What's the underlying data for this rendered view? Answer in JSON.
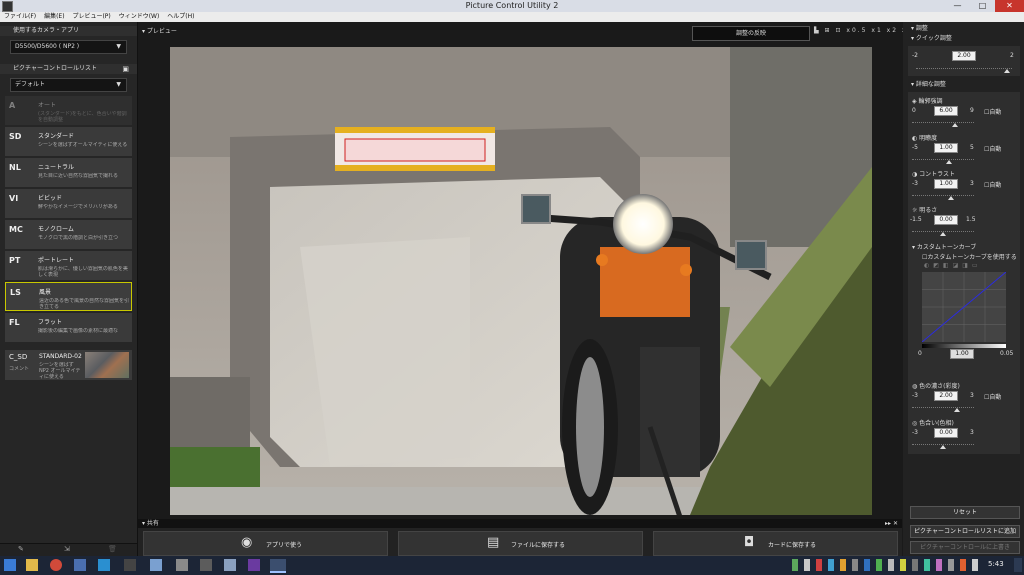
{
  "window": {
    "title": "Picture Control Utility 2",
    "minimize": "—",
    "maximize": "□",
    "close": "✕"
  },
  "menu": [
    "ファイル(F)",
    "編集(E)",
    "プレビュー(P)",
    "ウィンドウ(W)",
    "ヘルプ(H)"
  ],
  "left": {
    "camera_header": "使用するカメラ・アプリ",
    "camera_value": "D5500/D5600 ( NP2 )",
    "list_header": "ピクチャーコントロールリスト",
    "list_dropdown": "デフォルト",
    "items": [
      {
        "code": "A",
        "name": "オート",
        "desc": "(スタンダード)をもとに、色合いや階調を自動調整",
        "disabled": true
      },
      {
        "code": "SD",
        "name": "スタンダード",
        "desc": "シーンを選ばずオールマイティに使える"
      },
      {
        "code": "NL",
        "name": "ニュートラル",
        "desc": "見た目に近い自然な雰囲気で撮れる"
      },
      {
        "code": "VI",
        "name": "ビビッド",
        "desc": "鮮やかなイメージでメリハリがある"
      },
      {
        "code": "MC",
        "name": "モノクローム",
        "desc": "モノクロで黒の階調と白が引き立つ"
      },
      {
        "code": "PT",
        "name": "ポートレート",
        "desc": "肌は滑らかに、優しい雰囲気の肌色を美しく表現"
      },
      {
        "code": "LS",
        "name": "風景",
        "desc": "遠近のある色で風景の自然な雰囲気を引き立てる",
        "selected": true
      },
      {
        "code": "FL",
        "name": "フラット",
        "desc": "撮影後の編集で画像の素材に最適な"
      }
    ],
    "custom": {
      "code": "C_SD",
      "name": "STANDARD-02",
      "label": "コメント",
      "desc": "シーンを選ばず NP2 オールマイティに使える"
    },
    "bottom_icons": [
      "new-icon",
      "import-icon",
      "delete-icon"
    ]
  },
  "center": {
    "preview_label": "プレビュー",
    "apply_button": "調整の反映",
    "view_icons": "▙ ⊞ ⊡ x0.5 x1 x2 x4 ▭"
  },
  "share": {
    "header": "共有",
    "buttons": [
      {
        "icon": "app-icon",
        "label": "アプリで使う"
      },
      {
        "icon": "save-file-icon",
        "label": "ファイルに保存する"
      },
      {
        "icon": "camera-icon",
        "label": "カードに保存する"
      }
    ]
  },
  "right": {
    "header": "調整",
    "quick_header": "クイック調整",
    "quick": {
      "min": "-2",
      "value": "2.00",
      "max": "2"
    },
    "detail_header": "詳細な調整",
    "params": [
      {
        "label": "輪郭強調",
        "min": "0",
        "value": "6.00",
        "max": "9",
        "auto": "自動"
      },
      {
        "label": "明瞭度",
        "min": "-5",
        "value": "1.00",
        "max": "5",
        "auto": "自動"
      },
      {
        "label": "コントラスト",
        "min": "-3",
        "value": "1.00",
        "max": "3",
        "auto": "自動"
      },
      {
        "label": "明るさ",
        "min": "-1.5",
        "value": "0.00",
        "max": "1.5"
      }
    ],
    "tone_header": "カスタムトーンカーブ",
    "tone_use": "カスタムトーンカーブを使用する",
    "tone_range": {
      "min": "0",
      "mid": "1.00",
      "max": "0.05"
    },
    "saturation": {
      "label": "色の濃さ(彩度)",
      "min": "-3",
      "value": "2.00",
      "max": "3",
      "auto": "自動"
    },
    "hue": {
      "label": "色合い(色相)",
      "min": "-3",
      "value": "0.00",
      "max": "3"
    },
    "reset_button": "リセット",
    "add_button": "ピクチャーコントロールリストに追加",
    "overwrite_button": "ピクチャーコントロールに上書き"
  },
  "taskbar": {
    "time": "5:43"
  }
}
